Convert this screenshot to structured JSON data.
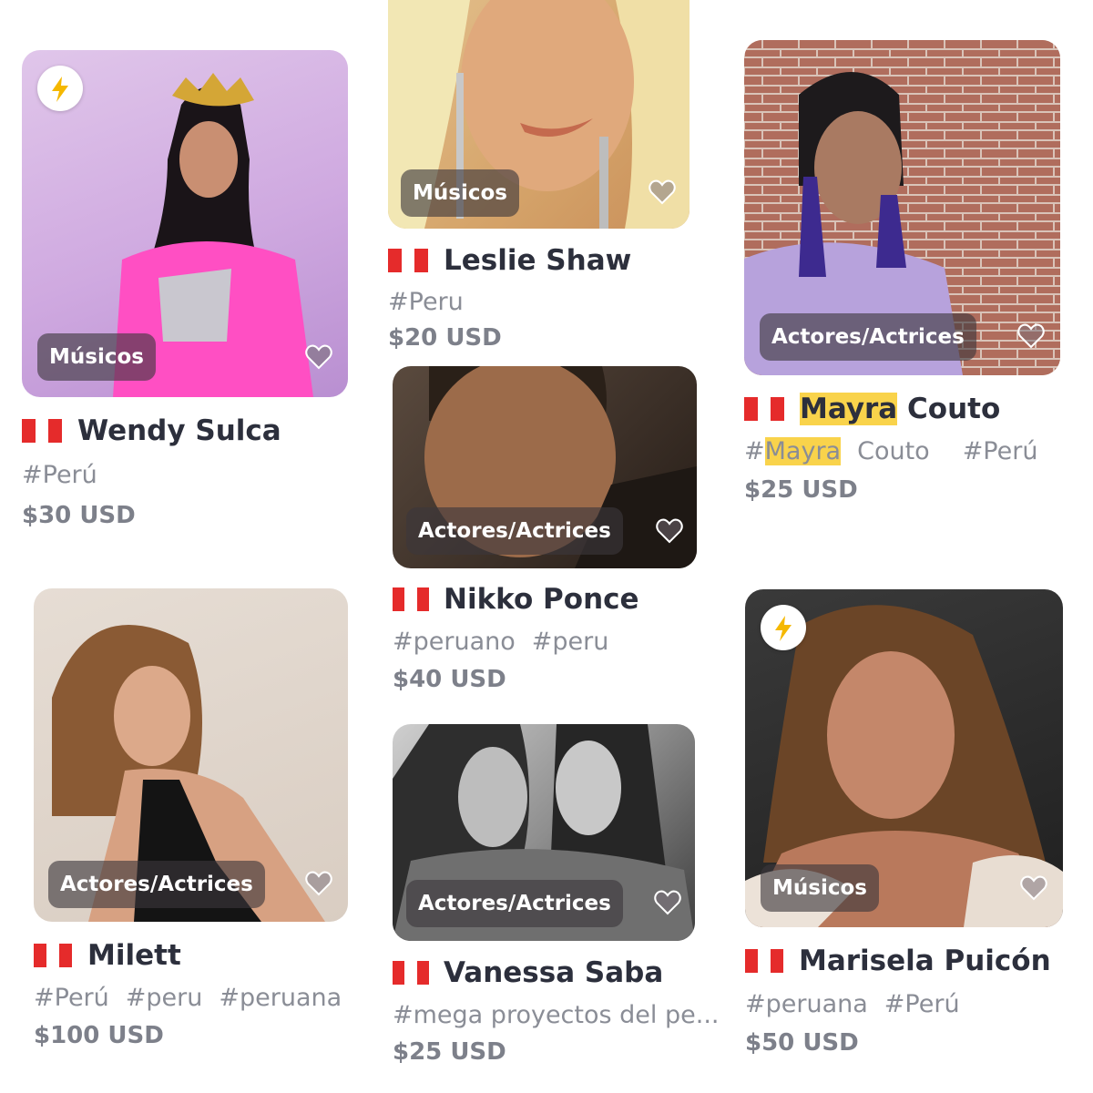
{
  "cards": [
    {
      "name_pre": "",
      "name_hl": "",
      "name": "Wendy Sulca",
      "category": "Músicos",
      "tags": [
        "#Perú"
      ],
      "price": "$30 USD",
      "fast": true
    },
    {
      "name_pre": "",
      "name_hl": "",
      "name": "Leslie Shaw",
      "category": "Músicos",
      "tags": [
        "#Peru"
      ],
      "price": "$20 USD",
      "fast": false
    },
    {
      "name_hl": "Mayra",
      "name": " Couto",
      "category": "Actores/Actrices",
      "tags_hl": "Mayra",
      "tags_rest": "Couto",
      "tags": [
        "#Perú"
      ],
      "price": "$25 USD",
      "fast": false
    },
    {
      "name": "Nikko Ponce",
      "category": "Actores/Actrices",
      "tags": [
        "#peruano",
        "#peru"
      ],
      "price": "$40 USD",
      "fast": false
    },
    {
      "name": "Milett",
      "category": "Actores/Actrices",
      "tags": [
        "#Perú",
        "#peru",
        "#peruana"
      ],
      "price": "$100 USD",
      "fast": false
    },
    {
      "name": "Vanessa Saba",
      "category": "Actores/Actrices",
      "tags": [
        "#mega proyectos del pe..."
      ],
      "price": "$25 USD",
      "fast": false
    },
    {
      "name": "Marisela Puicón",
      "category": "Músicos",
      "tags": [
        "#peruana",
        "#Perú"
      ],
      "price": "$50 USD",
      "fast": true
    }
  ],
  "colors": {
    "flag_red": "#e52b2b",
    "highlight": "#f9d34b",
    "fast_icon": "#f5b800"
  },
  "icons": {
    "fast": "lightning-bolt-icon",
    "favorite": "heart-outline-icon",
    "flag": "peru-flag-icon"
  }
}
